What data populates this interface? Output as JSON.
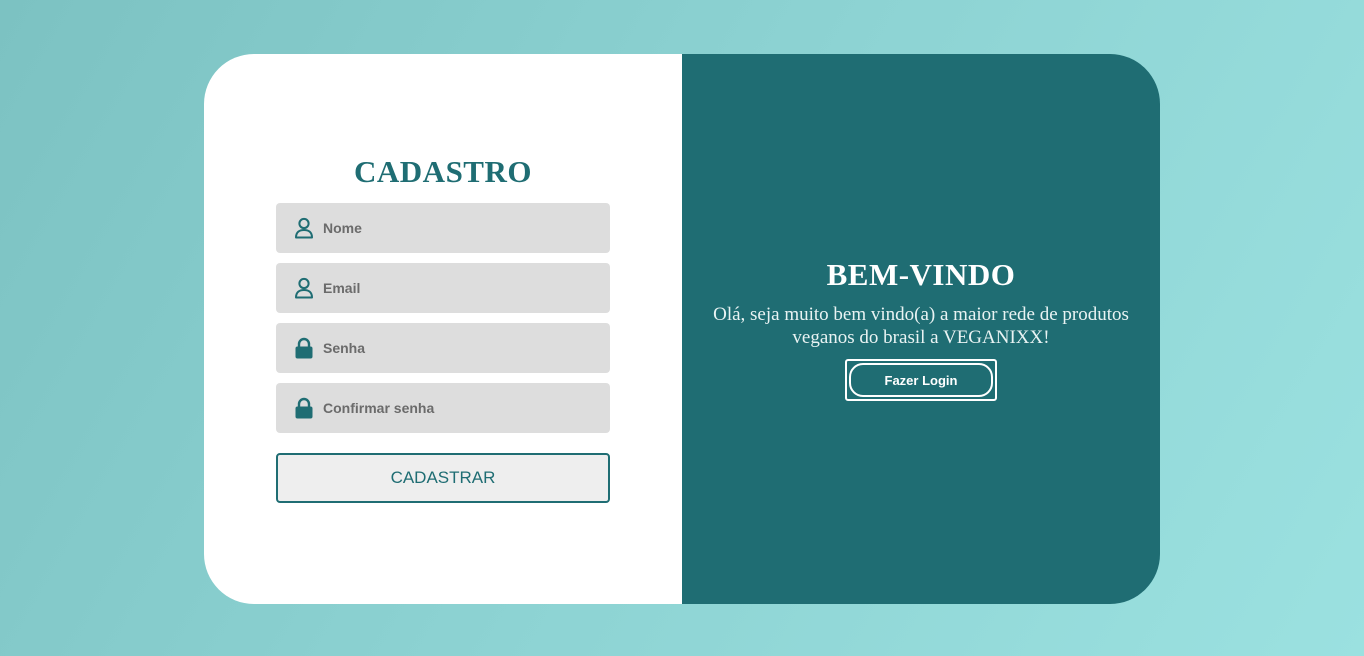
{
  "colors": {
    "accent": "#1f6d73",
    "field_bg": "#dddddd",
    "background_start": "#7cc2c2",
    "background_end": "#9be1e0"
  },
  "signup": {
    "title": "CADASTRO",
    "fields": [
      {
        "icon": "user-icon",
        "placeholder": "Nome",
        "value": ""
      },
      {
        "icon": "user-icon",
        "placeholder": "Email",
        "value": ""
      },
      {
        "icon": "lock-icon",
        "placeholder": "Senha",
        "value": ""
      },
      {
        "icon": "lock-icon",
        "placeholder": "Confirmar senha",
        "value": ""
      }
    ],
    "submit_label": "CADASTRAR"
  },
  "welcome": {
    "title": "BEM-VINDO",
    "message": "Olá, seja muito bem vindo(a) a maior rede de produtos veganos do brasil a VEGANIXX!",
    "login_label": "Fazer Login"
  }
}
